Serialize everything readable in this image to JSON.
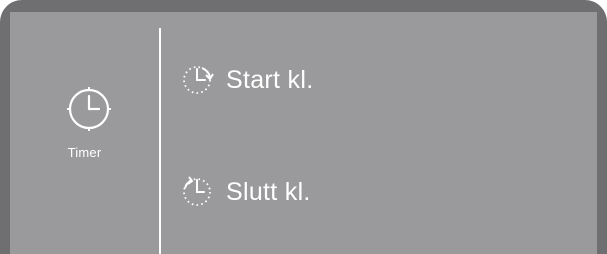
{
  "timer": {
    "label": "Timer",
    "icon": "clock-icon"
  },
  "options": {
    "start": {
      "label": "Start kl.",
      "icon": "start-time-icon"
    },
    "end": {
      "label": "Slutt kl.",
      "icon": "end-time-icon"
    }
  },
  "colors": {
    "frame": "#6f6f71",
    "screen": "#9a9a9c",
    "foreground": "#ffffff"
  }
}
